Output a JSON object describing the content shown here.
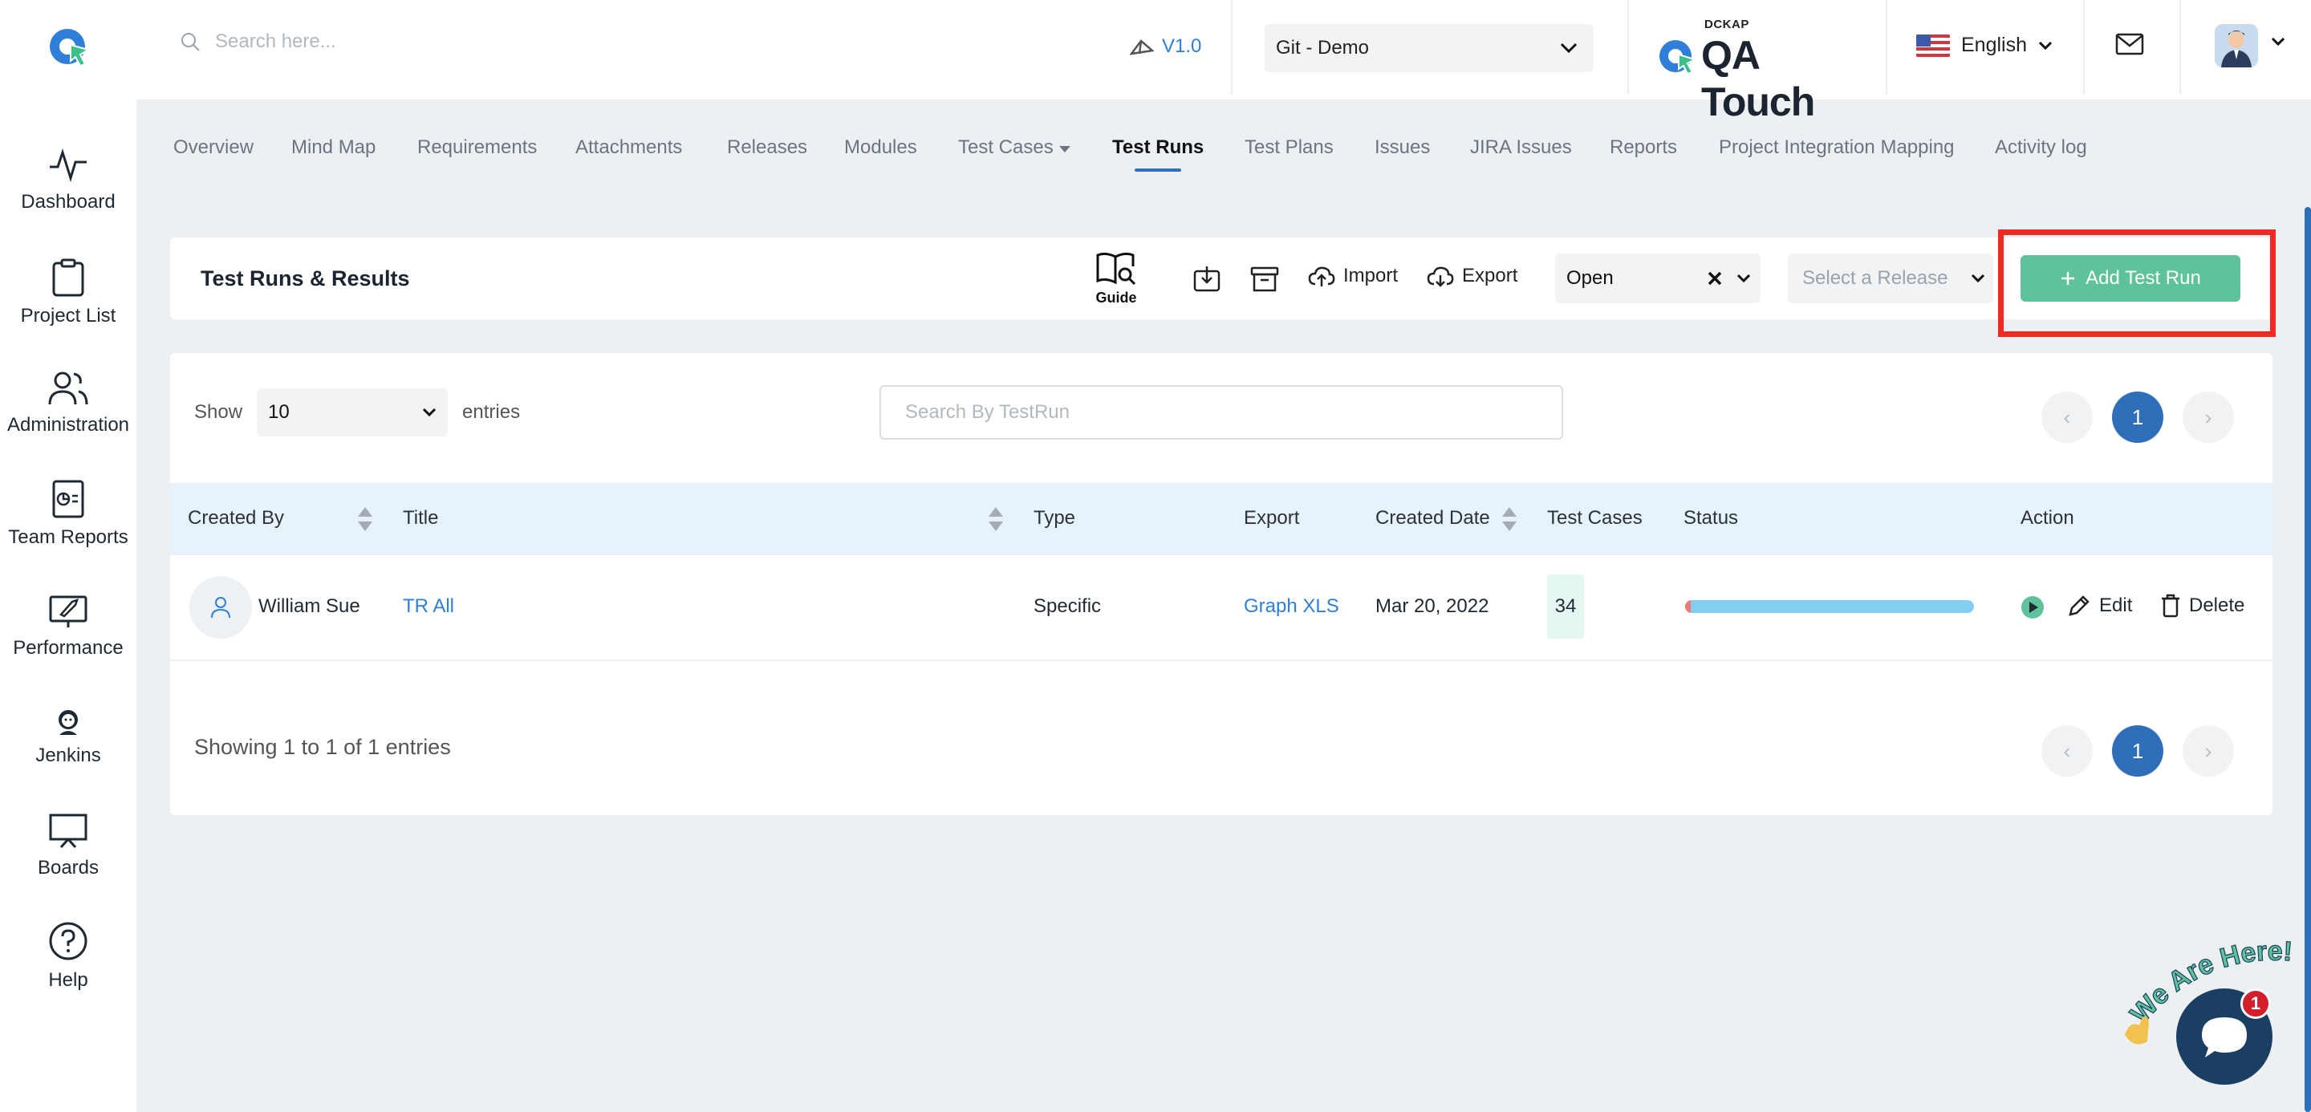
{
  "header": {
    "search_placeholder": "Search here...",
    "version": "V1.0",
    "project": "Git - Demo",
    "brand_small": "DCKAP",
    "brand_name": "QA Touch",
    "language": "English"
  },
  "sidebar": {
    "items": [
      {
        "label": "Dashboard",
        "icon": "pulse-icon"
      },
      {
        "label": "Project List",
        "icon": "clipboard-icon"
      },
      {
        "label": "Administration",
        "icon": "users-icon"
      },
      {
        "label": "Team Reports",
        "icon": "report-icon"
      },
      {
        "label": "Performance",
        "icon": "rocket-icon"
      },
      {
        "label": "Jenkins",
        "icon": "jenkins-icon"
      },
      {
        "label": "Boards",
        "icon": "board-icon"
      },
      {
        "label": "Help",
        "icon": "help-icon"
      }
    ]
  },
  "tabs": [
    "Overview",
    "Mind Map",
    "Requirements",
    "Attachments",
    "Releases",
    "Modules",
    "Test Cases",
    "Test Runs",
    "Test Plans",
    "Issues",
    "JIRA Issues",
    "Reports",
    "Project Integration Mapping",
    "Activity log"
  ],
  "active_tab": "Test Runs",
  "toolbar": {
    "title": "Test Runs & Results",
    "guide": "Guide",
    "import": "Import",
    "export": "Export",
    "status_value": "Open",
    "release_placeholder": "Select a Release",
    "add_button": "Add Test Run"
  },
  "table": {
    "show_label": "Show",
    "entries_value": "10",
    "entries_label": "entries",
    "search_placeholder": "Search By TestRun",
    "current_page": "1",
    "columns": [
      "Created By",
      "Title",
      "Type",
      "Export",
      "Created Date",
      "Test Cases",
      "Status",
      "Action"
    ],
    "rows": [
      {
        "created_by": "William Sue",
        "title": "TR All",
        "type": "Specific",
        "export": "Graph XLS",
        "created_date": "Mar 20, 2022",
        "test_cases": "34",
        "status_fail_fraction": 0.02,
        "edit": "Edit",
        "delete": "Delete"
      }
    ],
    "footer": "Showing 1 to 1 of 1 entries"
  },
  "chat": {
    "text": "We Are Here!",
    "badge": "1"
  },
  "colors": {
    "accent": "#2f6fba",
    "add_button": "#5ec29a",
    "highlight": "#ef2a22",
    "link": "#2f7fd8"
  }
}
